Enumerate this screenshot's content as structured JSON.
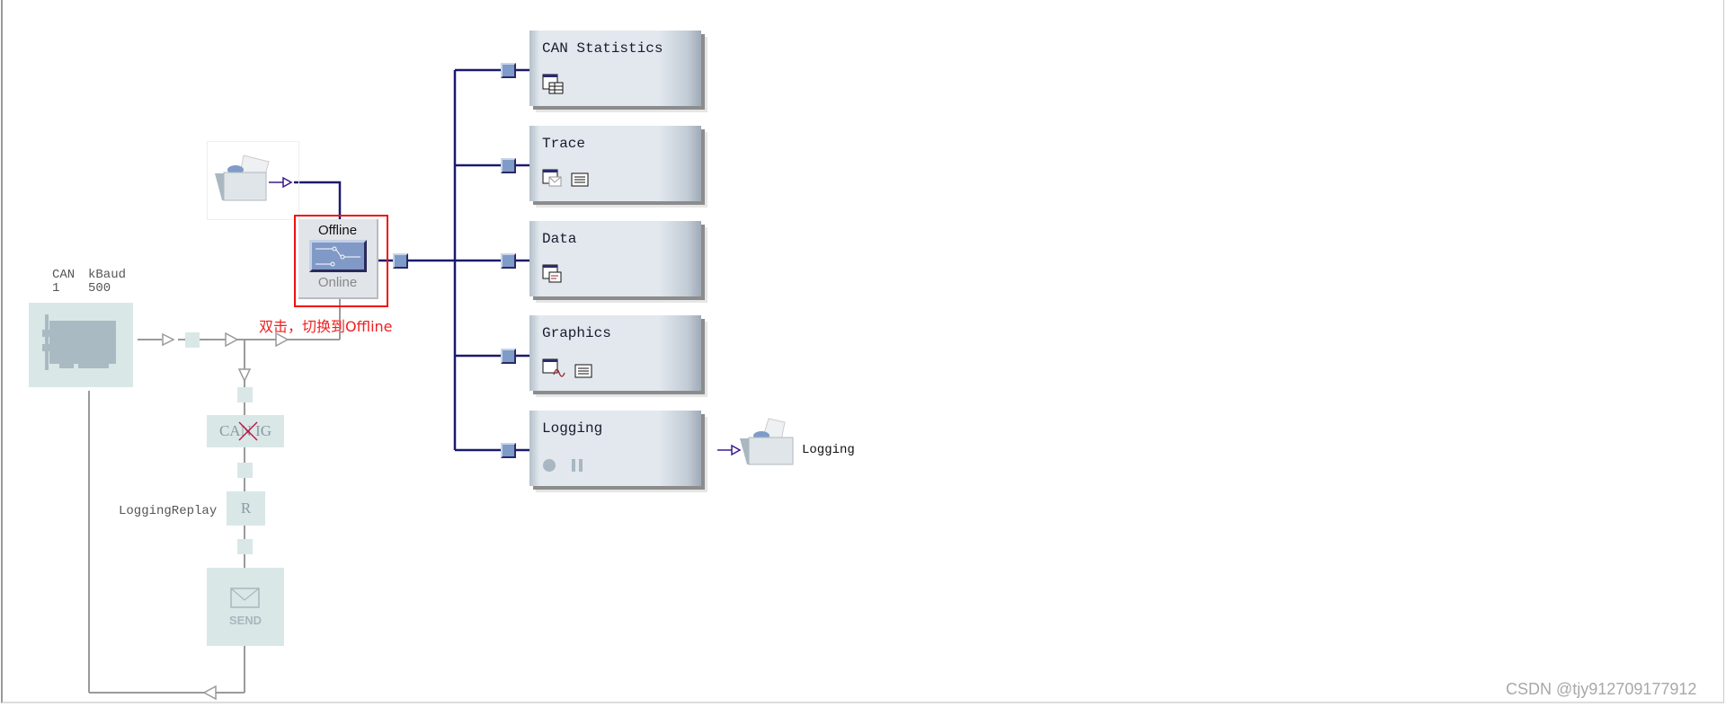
{
  "can_card": {
    "channel_header": "CAN",
    "channel_value": "1",
    "baud_header": "kBaud",
    "baud_value": "500"
  },
  "offline_switch": {
    "top_label": "Offline",
    "bottom_label": "Online",
    "icon": "switch-icon"
  },
  "annotation": {
    "text": "双击，切换到Offline",
    "color": "#f02020"
  },
  "replay_chain": {
    "canig_label": "CAN IG",
    "r_label": "R",
    "replay_name": "LoggingReplay",
    "send_label": "SEND"
  },
  "analysis_blocks": [
    {
      "title": "CAN Statistics",
      "icons": [
        "statistics-table-icon"
      ]
    },
    {
      "title": "Trace",
      "icons": [
        "trace-window-icon",
        "config-sheet-icon"
      ]
    },
    {
      "title": "Data",
      "icons": [
        "data-window-icon"
      ]
    },
    {
      "title": "Graphics",
      "icons": [
        "graphics-window-icon",
        "config-sheet-icon"
      ]
    },
    {
      "title": "Logging",
      "icons": [
        "record-icon",
        "pause-icon"
      ]
    }
  ],
  "logging_output": {
    "label": "Logging",
    "icon": "folder-icon"
  },
  "watermark": "CSDN @tjy912709177912",
  "colors": {
    "bus": "#1a1a6e",
    "inactive": "#d9e7e7",
    "highlight": "#f01010",
    "port": "#7f9bc8"
  }
}
